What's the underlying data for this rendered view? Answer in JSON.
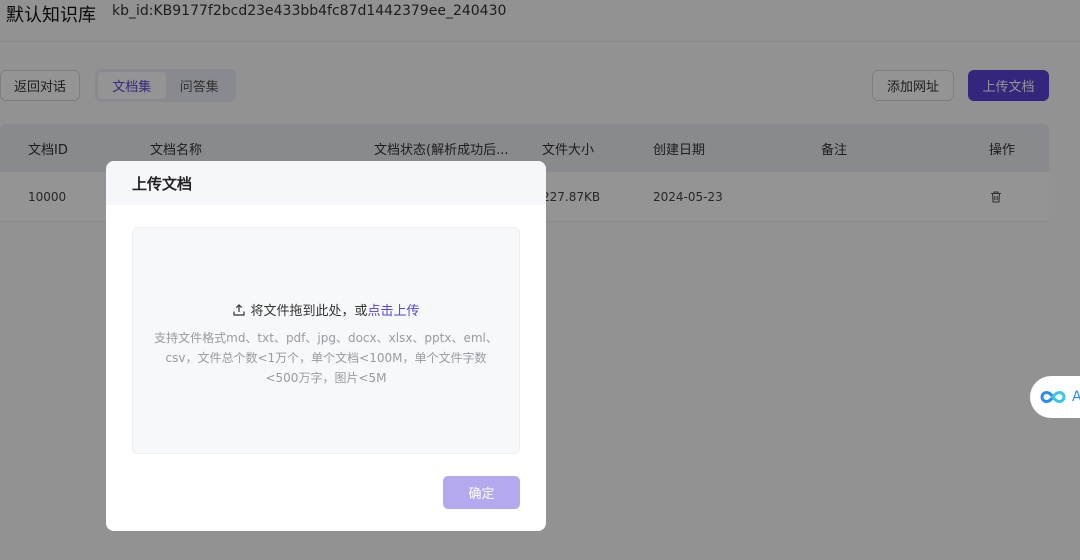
{
  "header": {
    "title": "默认知识库",
    "kb_id": "kb_id:KB9177f2bcd23e433bb4fc87d1442379ee_240430"
  },
  "toolbar": {
    "back_label": "返回对话",
    "tabs": [
      {
        "label": "文档集",
        "active": true
      },
      {
        "label": "问答集",
        "active": false
      }
    ],
    "add_url_label": "添加网址",
    "upload_label": "上传文档"
  },
  "table": {
    "columns": [
      "文档ID",
      "文档名称",
      "文档状态(解析成功后...",
      "文件大小",
      "创建日期",
      "备注",
      "操作"
    ],
    "rows": [
      {
        "id": "10000",
        "name": "",
        "status": "",
        "size": "227.87KB",
        "date": "2024-05-23",
        "note": ""
      }
    ]
  },
  "dialog": {
    "title": "上传文档",
    "drop_text": "将文件拖到此处，或",
    "drop_link": "点击上传",
    "hint": "支持文件格式md、txt、pdf、jpg、docx、xlsx、pptx、eml、csv，文件总个数<1万个，单个文档<100M，单个文件字数<500万字，图片<5M",
    "confirm_label": "确定"
  },
  "widget": {
    "icon": "infinity-icon",
    "text": "A"
  },
  "colors": {
    "accent": "#5a42d8",
    "accent_disabled": "#b4a9ef"
  }
}
